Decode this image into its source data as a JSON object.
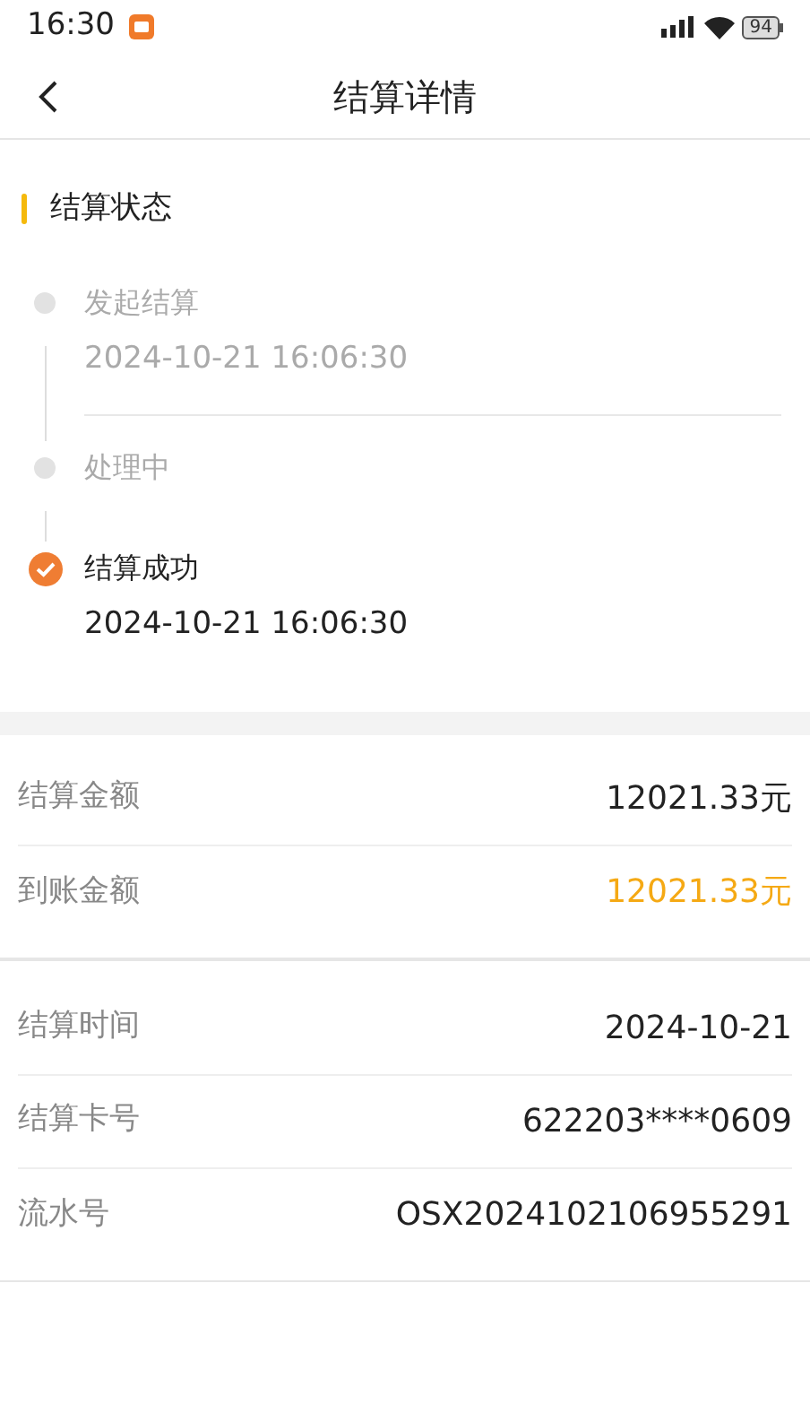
{
  "status_bar": {
    "time": "16:30",
    "battery": "94"
  },
  "header": {
    "title": "结算详情"
  },
  "status_section": {
    "title": "结算状态",
    "steps": [
      {
        "title": "发起结算",
        "time": "2024-10-21 16:06:30",
        "completed": false
      },
      {
        "title": "处理中",
        "completed": false
      },
      {
        "title": "结算成功",
        "time": "2024-10-21 16:06:30",
        "completed": true
      }
    ]
  },
  "amounts": [
    {
      "label": "结算金额",
      "value": "12021.33元",
      "highlighted": false
    },
    {
      "label": "到账金额",
      "value": "12021.33元",
      "highlighted": true
    }
  ],
  "details": [
    {
      "label": "结算时间",
      "value": "2024-10-21"
    },
    {
      "label": "结算卡号",
      "value": "622203****0609"
    },
    {
      "label": "流水号",
      "value": "OSX2024102106955291"
    }
  ]
}
